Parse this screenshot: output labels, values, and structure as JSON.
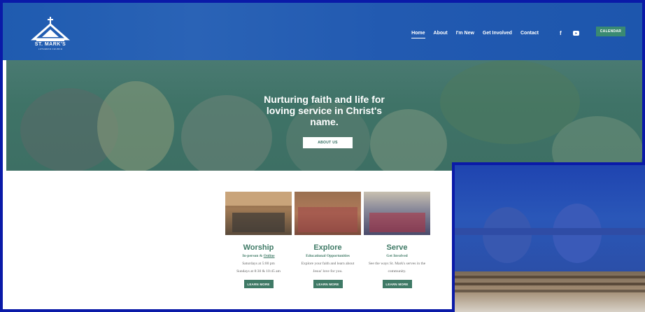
{
  "logo": {
    "name": "ST. MARK'S",
    "subtitle": "LUTHERAN CHURCH",
    "icon": "church-logo-icon"
  },
  "nav": {
    "items": [
      {
        "label": "Home",
        "active": true
      },
      {
        "label": "About",
        "active": false
      },
      {
        "label": "I'm New",
        "active": false
      },
      {
        "label": "Get Involved",
        "active": false
      },
      {
        "label": "Contact",
        "active": false
      }
    ],
    "facebook": "f",
    "calendar_label": "CALENDAR"
  },
  "hero": {
    "title_line1": "Nurturing faith and life for",
    "title_line2": "loving service in Christ's",
    "title_line3": "name.",
    "button_label": "ABOUT US"
  },
  "cards": [
    {
      "title": "Worship",
      "sub_prefix": "In-person & ",
      "sub_link": "Online",
      "line1": "Saturdays at 5:00 pm",
      "line2": "Sundays at 8:30 & 10:45 am",
      "button": "LEARN MORE"
    },
    {
      "title": "Explore",
      "sub": "Educational Opportunities",
      "line1": "Explore your faith and learn about",
      "line2": "Jesus' love for you.",
      "button": "LEARN MORE"
    },
    {
      "title": "Serve",
      "sub": "Get Involved",
      "line1": "See the ways St. Mark's serves in the",
      "line2": "community.",
      "button": "LEARN MORE"
    }
  ],
  "colors": {
    "header": "#225ab1",
    "accent": "#3f7a66",
    "frame": "#0a1aa8"
  }
}
